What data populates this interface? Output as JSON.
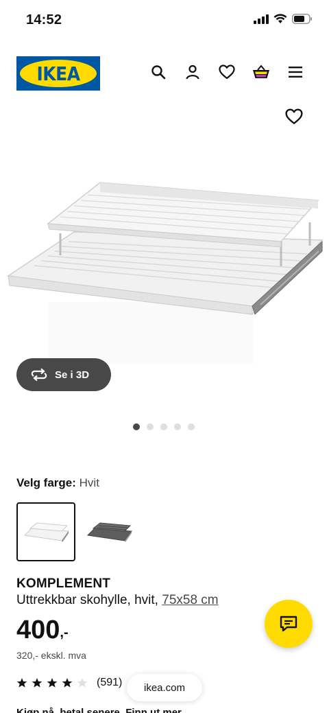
{
  "status": {
    "time": "14:52"
  },
  "header": {
    "logo_text": "IKEA",
    "icons": [
      "search-icon",
      "user-icon",
      "heart-icon",
      "basket-icon",
      "menu-icon"
    ]
  },
  "gallery": {
    "view_3d_label": "Se i 3D",
    "page_count": 5,
    "active_page": 1
  },
  "color_picker": {
    "label": "Velg farge:",
    "selected_value": "Hvit"
  },
  "product": {
    "name": "KOMPLEMENT",
    "description": "Uttrekkbar skohylle, hvit,",
    "size_link": "75x58 cm",
    "price": "400",
    "price_suffix": ",-",
    "price_ex_vat": "320,- ekskl. mva",
    "rating": 4,
    "rating_max": 5,
    "review_count": "(591)"
  },
  "browser": {
    "url": "ikea.com"
  },
  "partial_line": "Kjøp nå, betal senere. Finn ut mer",
  "colors": {
    "ikea_blue": "#0058a3",
    "ikea_yellow": "#ffdb00",
    "dark_grey": "#484848"
  }
}
